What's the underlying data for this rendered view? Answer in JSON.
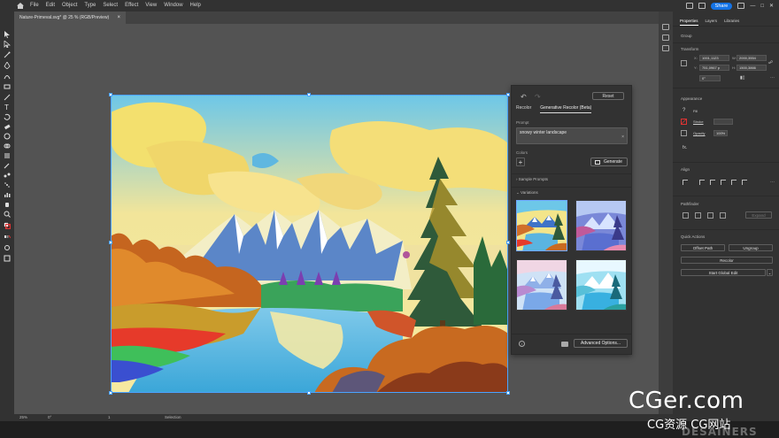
{
  "menubar": {
    "items": [
      "File",
      "Edit",
      "Object",
      "Type",
      "Select",
      "Effect",
      "View",
      "Window",
      "Help"
    ],
    "share_label": "Share"
  },
  "document": {
    "tab_title": "Nature-Primeval.svg* @ 25 % (RGB/Preview)"
  },
  "recolor_panel": {
    "reset_label": "Reset",
    "tabs": [
      "Recolor",
      "Generative Recolor (Beta)"
    ],
    "prompt_label": "Prompt",
    "prompt_value": "snowy winter landscape",
    "colors_label": "Colors",
    "generate_label": "Generate",
    "sample_prompts_label": "Sample Prompts",
    "variations_label": "Variations",
    "advanced_options_label": "Advanced Options..."
  },
  "properties_panel": {
    "tabs": [
      "Properties",
      "Layers",
      "Libraries"
    ],
    "group_label": "Group",
    "transform_label": "Transform",
    "x_label": "X:",
    "x_value": "1001,1123",
    "y_label": "Y:",
    "y_value": "751,0967 p",
    "w_label": "W:",
    "w_value": "2000,3554",
    "h_label": "H:",
    "h_value": "1500,3866",
    "rotate_value": "0°",
    "appearance_label": "Appearance",
    "fill_label": "Fill",
    "stroke_label": "Stroke",
    "opacity_label": "Opacity",
    "opacity_value": "100%",
    "fx_label": "fx.",
    "align_label": "Align",
    "pathfinder_label": "Pathfinder",
    "expand_label": "Expand",
    "quick_actions_label": "Quick Actions",
    "offset_path_label": "Offset Path",
    "ungroup_label": "Ungroup",
    "recolor_label": "Recolor",
    "start_global_edit_label": "Start Global Edit"
  },
  "statusbar": {
    "zoom": "25%",
    "rotation": "0°",
    "artboard": "1",
    "tool": "Selection"
  },
  "watermark": {
    "main": "CGer.com",
    "sub": "CG资源 CG网站",
    "brand": "DESAINERS"
  },
  "colors": {
    "accent_blue": "#1473e6",
    "panel_bg": "#323232",
    "canvas_bg": "#535353"
  }
}
